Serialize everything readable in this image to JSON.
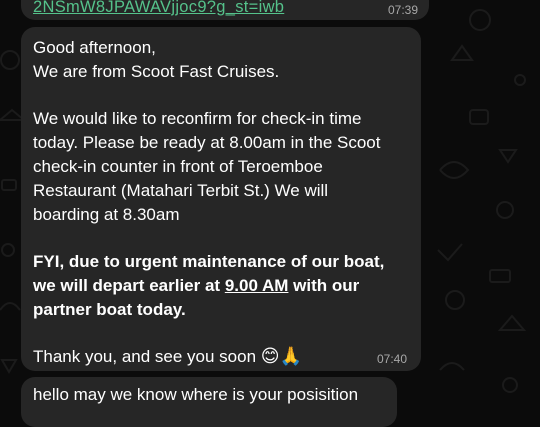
{
  "messages": {
    "top": {
      "link": "2NSmW8JPAWAVjjoc9?g_st=iwb",
      "time": "07:39"
    },
    "main": {
      "lines": [
        "Good afternoon,",
        "We are from Scoot Fast Cruises.",
        "We would like to reconfirm for check-in time",
        "today. Please be ready at 8.00am in the Scoot",
        "check-in counter in front of Teroemboe",
        "Restaurant (Matahari Terbit St.) We will",
        "boarding at 8.30am",
        "FYI, due to urgent maintenance of our boat,",
        "we will depart earlier at ",
        "9.00 AM",
        " with our",
        "partner boat today.",
        "Thank you, and see you soon ",
        "😊🙏"
      ],
      "time": "07:40"
    },
    "bottom": {
      "text": "hello may we know where is your posisition"
    }
  },
  "colors": {
    "background": "#0b0b0b",
    "bubble": "#262626",
    "link": "#55c28b",
    "timestamp": "#a8a8a8"
  }
}
